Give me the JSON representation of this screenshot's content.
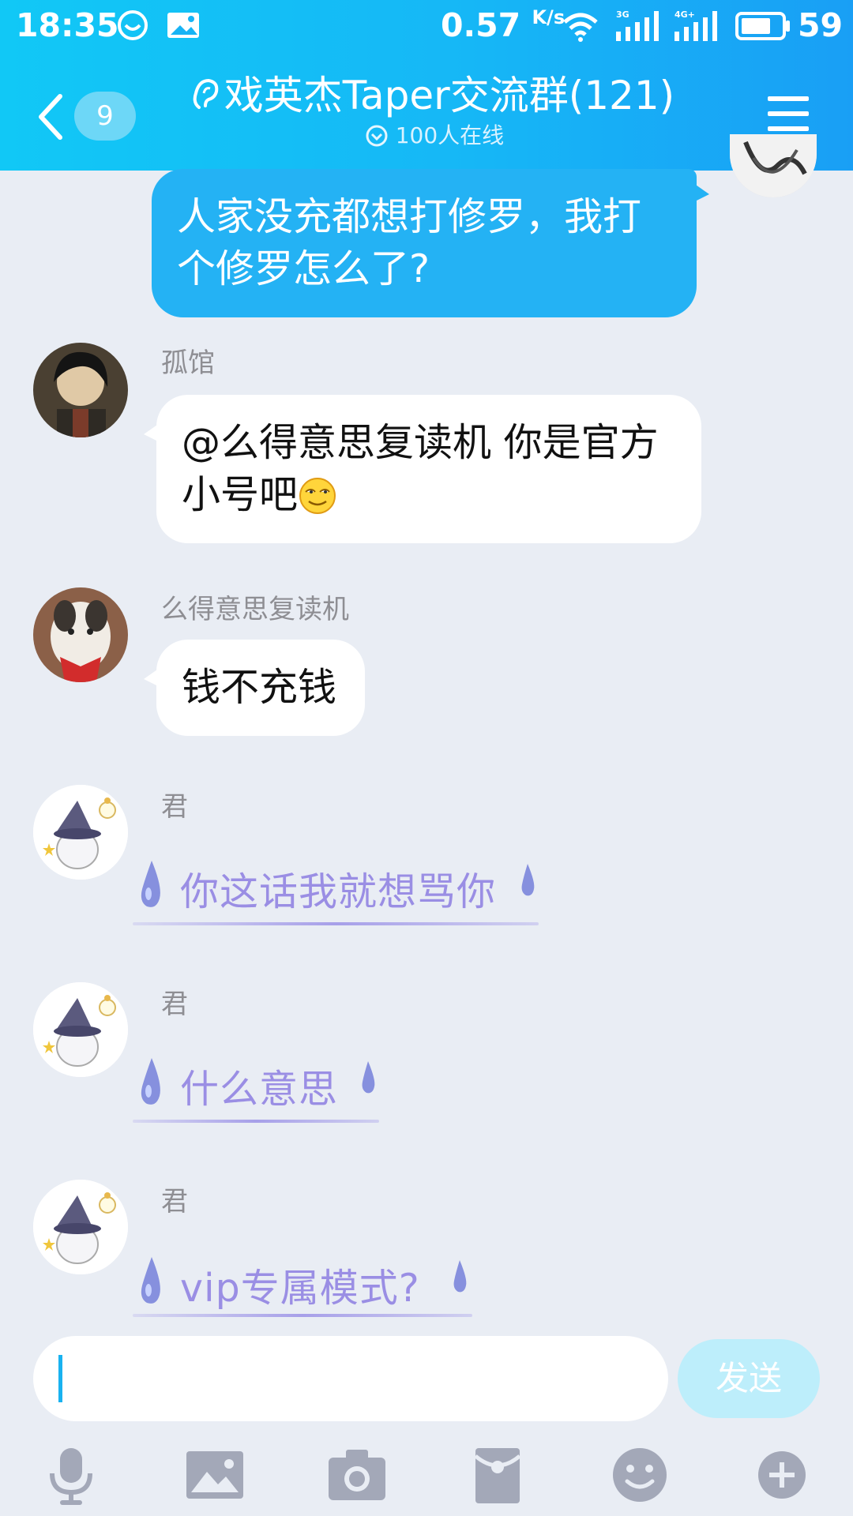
{
  "status_bar": {
    "time": "18:35",
    "net_speed": "0.57",
    "net_unit": "K/s",
    "signal_1_label": "3G",
    "signal_2_label": "4G+",
    "battery": "59"
  },
  "header": {
    "back_badge": "9",
    "title": "戏英杰Taper交流群(121)",
    "online_count": "100人在线"
  },
  "messages": [
    {
      "side": "right",
      "text_line1": "人家没充都想打修罗，我打",
      "text_line2": "个修罗怎么了?"
    },
    {
      "side": "left",
      "sender": "孤馆",
      "text_line1": "@么得意思复读机 你是官方",
      "text_line2": "小号吧"
    },
    {
      "side": "left",
      "sender": "么得意思复读机",
      "text": "钱不充钱"
    },
    {
      "side": "left",
      "sender": "君",
      "text": "你这话我就想骂你"
    },
    {
      "side": "left",
      "sender": "君",
      "text": "什么意思"
    },
    {
      "side": "left",
      "sender": "君",
      "text": "vip专属模式?"
    }
  ],
  "composer": {
    "input_value": "",
    "send_label": "发送"
  },
  "colors": {
    "header_start": "#11c8f6",
    "header_end": "#199ff5",
    "my_bubble": "#24b2f4",
    "fancy_text": "#9a8ee4",
    "background": "#e9edf4"
  },
  "toolbar_icons": [
    "microphone-icon",
    "image-icon",
    "camera-icon",
    "red-packet-icon",
    "emoji-icon",
    "plus-icon"
  ]
}
